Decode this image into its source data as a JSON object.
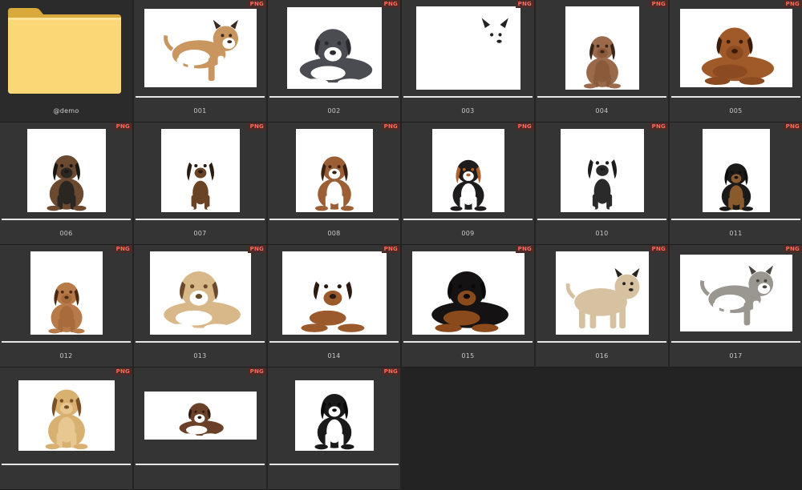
{
  "folder": {
    "name": "@demo",
    "icon": "folder-icon"
  },
  "items": [
    {
      "label": "001",
      "badge": "PNG",
      "subject": "bulldog",
      "fur": "#c99660",
      "fur2": "#ffffff",
      "dark": "#3a2a22",
      "pose": "standing"
    },
    {
      "label": "002",
      "badge": "PNG",
      "subject": "pit-bull-puppy",
      "fur": "#4b4b52",
      "fur2": "#ffffff",
      "dark": "#2a2a2e",
      "pose": "lying"
    },
    {
      "label": "003",
      "badge": "PNG",
      "subject": "dalmatian",
      "fur": "#ffffff",
      "fur2": "#ffffff",
      "dark": "#222222",
      "pose": "standing"
    },
    {
      "label": "004",
      "badge": "PNG",
      "subject": "shar-pei",
      "fur": "#9a6a4a",
      "fur2": "#8a5a3c",
      "dark": "#3a2418",
      "pose": "sitting"
    },
    {
      "label": "005",
      "badge": "PNG",
      "subject": "dogue-de-bordeaux",
      "fur": "#a05a2a",
      "fur2": "#8c4a20",
      "dark": "#3a1c0c",
      "pose": "lying"
    },
    {
      "label": "006",
      "badge": "PNG",
      "subject": "yorkshire-terrier",
      "fur": "#6b4a30",
      "fur2": "#2a2622",
      "dark": "#1a1614",
      "pose": "sitting"
    },
    {
      "label": "007",
      "badge": "PNG",
      "subject": "basset-hound",
      "fur": "#ffffff",
      "fur2": "#6a4224",
      "dark": "#2a1a10",
      "pose": "sitting"
    },
    {
      "label": "008",
      "badge": "PNG",
      "subject": "australian-shepherd",
      "fur": "#9c5e34",
      "fur2": "#ffffff",
      "dark": "#3a2010",
      "pose": "sitting"
    },
    {
      "label": "009",
      "badge": "PNG",
      "subject": "bernese-mountain-dog",
      "fur": "#1e1c1c",
      "fur2": "#ffffff",
      "dark": "#b0602a",
      "pose": "sitting"
    },
    {
      "label": "010",
      "badge": "PNG",
      "subject": "french-bulldog",
      "fur": "#ffffff",
      "fur2": "#2a2a2a",
      "dark": "#1c1c1c",
      "pose": "sitting"
    },
    {
      "label": "011",
      "badge": "PNG",
      "subject": "german-shepherd-puppy",
      "fur": "#1c1a18",
      "fur2": "#8a5a2c",
      "dark": "#0e0e0e",
      "pose": "sitting"
    },
    {
      "label": "012",
      "badge": "PNG",
      "subject": "cocker-spaniel",
      "fur": "#b77a48",
      "fur2": "#a86c3c",
      "dark": "#4a2a14",
      "pose": "sitting"
    },
    {
      "label": "013",
      "badge": "PNG",
      "subject": "staffordshire-terrier",
      "fur": "#d8b888",
      "fur2": "#ffffff",
      "dark": "#6a4a2a",
      "pose": "lying"
    },
    {
      "label": "014",
      "badge": "PNG",
      "subject": "beagle",
      "fur": "#ffffff",
      "fur2": "#9a5a2c",
      "dark": "#2a1a10",
      "pose": "lying"
    },
    {
      "label": "015",
      "badge": "PNG",
      "subject": "rottweiler-puppy",
      "fur": "#141212",
      "fur2": "#8a4a1c",
      "dark": "#0a0a0a",
      "pose": "lying"
    },
    {
      "label": "016",
      "badge": "PNG",
      "subject": "pug",
      "fur": "#d6c2a0",
      "fur2": "#d6c2a0",
      "dark": "#2a2420",
      "pose": "standing"
    },
    {
      "label": "017",
      "badge": "PNG",
      "subject": "husky-puppy",
      "fur": "#9a9690",
      "fur2": "#ffffff",
      "dark": "#4a4642",
      "pose": "standing"
    },
    {
      "label": "",
      "badge": "PNG",
      "subject": "golden-retriever-puppy",
      "fur": "#d8b070",
      "fur2": "#e8c890",
      "dark": "#7a5024",
      "pose": "sitting"
    },
    {
      "label": "",
      "badge": "PNG",
      "subject": "border-collie",
      "fur": "#6a4028",
      "fur2": "#ffffff",
      "dark": "#2a1a10",
      "pose": "lying"
    },
    {
      "label": "",
      "badge": "PNG",
      "subject": "french-bulldog-black",
      "fur": "#1a1a1a",
      "fur2": "#ffffff",
      "dark": "#0a0a0a",
      "pose": "sitting"
    }
  ]
}
